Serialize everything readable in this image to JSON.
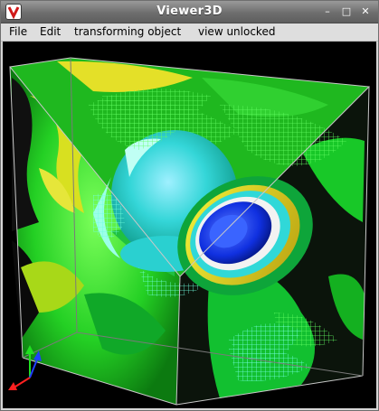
{
  "window": {
    "title": "Viewer3D",
    "controls": {
      "minimize": "–",
      "maximize": "□",
      "close": "✕"
    }
  },
  "menubar": {
    "items": [
      {
        "label": "File"
      },
      {
        "label": "Edit"
      },
      {
        "label": "transforming object"
      },
      {
        "label": "view unlocked"
      }
    ]
  },
  "viewport": {
    "background": "#000000",
    "scene": "isosurface-cube",
    "palette": {
      "green": "#22dd22",
      "cyan": "#33e0e0",
      "yellow": "#e8e820",
      "blue": "#1030e0",
      "white": "#f0f0f0"
    }
  },
  "axis_gizmo": {
    "x_color": "#ff2020",
    "y_color": "#20e020",
    "z_color": "#2040ff"
  }
}
